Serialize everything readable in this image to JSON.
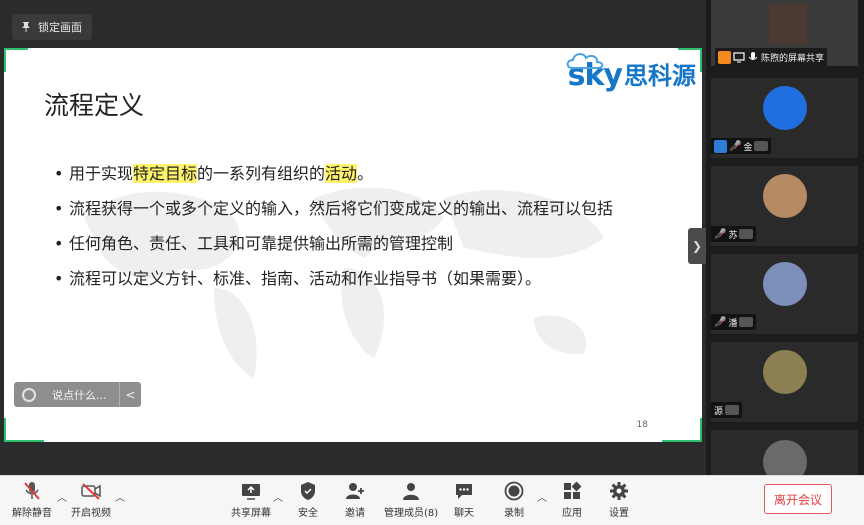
{
  "share": {
    "lock_label": "锁定画面",
    "slide": {
      "title": "流程定义",
      "logo_latin": "sky",
      "logo_cn": "思科源",
      "bullets": [
        {
          "pre": "用于实现",
          "hl1": "特定目标",
          "mid": "的一系列有组织的",
          "hl2": "活动",
          "post": "。"
        },
        {
          "text": "流程获得一个或多个定义的输入，然后将它们变成定义的输出、流程可以包括"
        },
        {
          "text": "任何角色、责任、工具和可靠提供输出所需的管理控制"
        },
        {
          "text": "流程可以定义方针、标准、指南、活动和作业指导书（如果需要）。"
        }
      ],
      "page_number": "18",
      "highlight_color": "#fff36b",
      "accent_color": "#2fbf71"
    },
    "chat_placeholder": "说点什么...",
    "chat_collapse": "<"
  },
  "gallery": {
    "expand_label": "❯",
    "tiles": [
      {
        "name": "陈煦的屏幕共享"
      },
      {
        "name": "金"
      },
      {
        "name": "苏"
      },
      {
        "name": "潘"
      },
      {
        "name": "源"
      },
      {
        "name": ""
      }
    ]
  },
  "toolbar": {
    "mute": "解除静音",
    "video": "开启视频",
    "share": "共享屏幕",
    "security": "安全",
    "invite": "邀请",
    "members": "管理成员(8)",
    "chat": "聊天",
    "record": "录制",
    "apps": "应用",
    "settings": "设置",
    "leave": "离开会议"
  }
}
